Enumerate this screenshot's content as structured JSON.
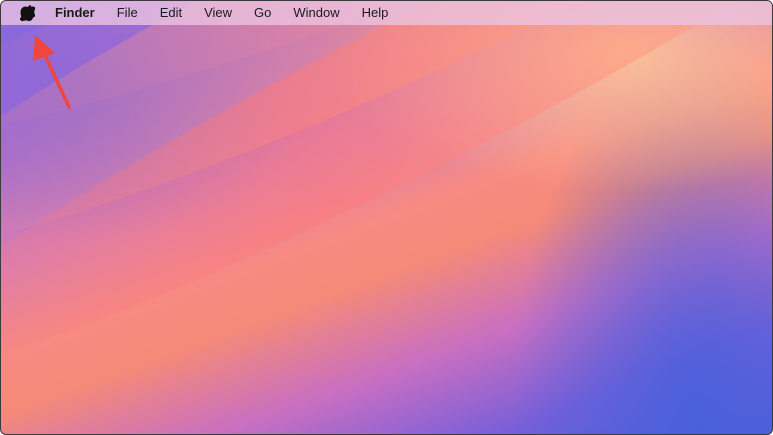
{
  "menubar": {
    "apple_icon": "apple-logo-icon",
    "app_name": "Finder",
    "items": [
      "File",
      "Edit",
      "View",
      "Go",
      "Window",
      "Help"
    ]
  },
  "annotation": {
    "arrow_color": "#f0463c",
    "icon": "red-arrow-icon"
  },
  "colors": {
    "menubar_bg": "#ecc4e2",
    "wallpaper_purple": "#8a6fd8",
    "wallpaper_orange": "#f78a82",
    "wallpaper_blue": "#4a62d6"
  }
}
